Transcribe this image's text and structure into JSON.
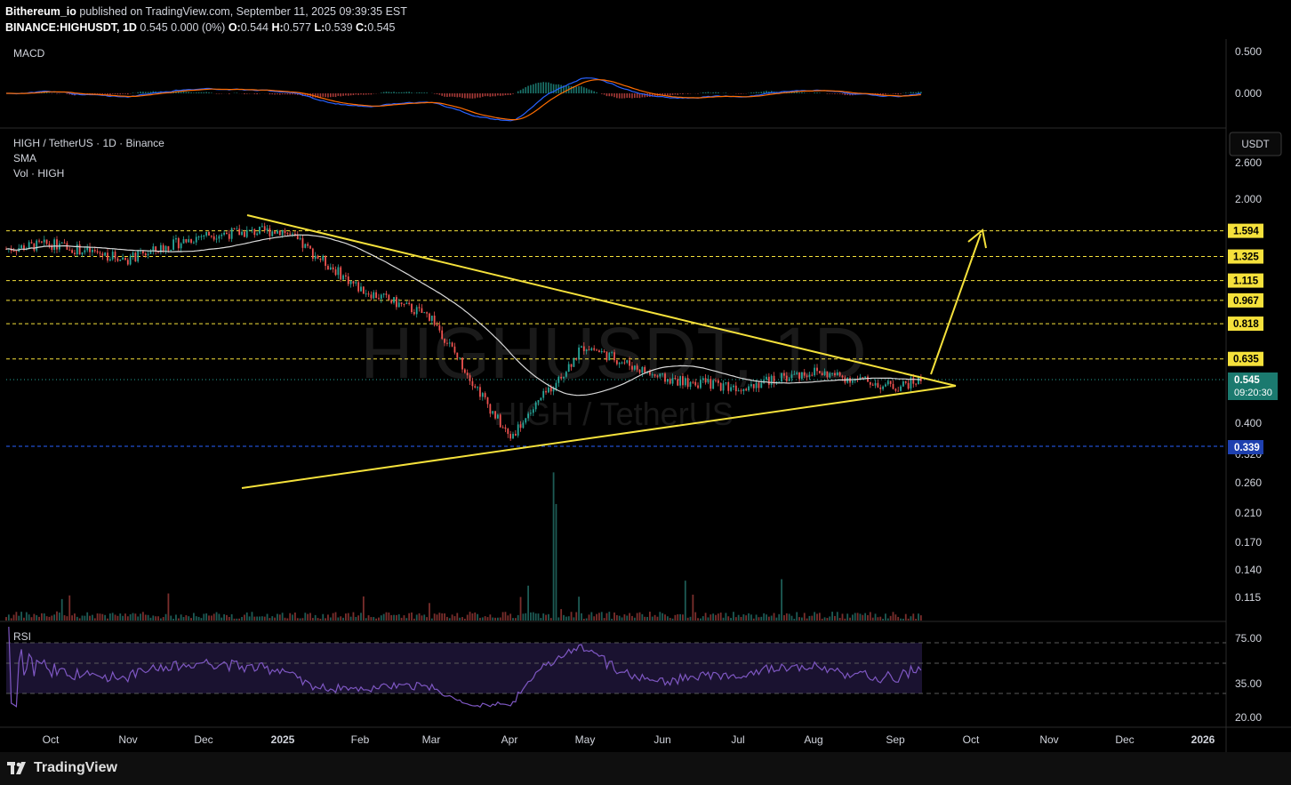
{
  "header": {
    "author": "Bithereum_io",
    "published": "published on TradingView.com, September 11, 2025 09:39:35 EST",
    "symbol": "BINANCE:HIGHUSDT, 1D",
    "change": "0.545 0.000 (0%)",
    "o_label": "O:",
    "o": "0.544",
    "h_label": "H:",
    "h": "0.577",
    "l_label": "L:",
    "l": "0.539",
    "c_label": "C:",
    "c": "0.545"
  },
  "macd": {
    "label": "MACD",
    "ticks": [
      "0.500",
      "0.000"
    ]
  },
  "main": {
    "title": "HIGH / TetherUS · 1D · Binance",
    "sma_label": "SMA",
    "vol_label": "Vol · HIGH",
    "currency": "USDT",
    "watermark_symbol": "HIGHUSDT, 1D",
    "watermark_name": "HIGH / TetherUS",
    "price_ticks": [
      "2.600",
      "2.000",
      "0.400",
      "0.320",
      "0.260",
      "0.210",
      "0.170",
      "0.140",
      "0.115"
    ],
    "current_price": "0.545",
    "countdown": "09:20:30",
    "support": "0.339"
  },
  "rsi": {
    "label": "RSI",
    "ticks": [
      "75.00",
      "35.00",
      "20.00"
    ]
  },
  "time_axis": [
    "Oct",
    "Nov",
    "Dec",
    "2025",
    "Feb",
    "Mar",
    "Apr",
    "May",
    "Jun",
    "Jul",
    "Aug",
    "Sep",
    "Oct",
    "Nov",
    "Dec",
    "2026"
  ],
  "footer": {
    "brand": "TradingView"
  },
  "colors": {
    "level_line": "#f5e13b",
    "trend_line": "#f5e13b",
    "support_line": "#2962ff",
    "candle_up": "#26a69a",
    "candle_down": "#ef5350",
    "sma": "#cfcfcf",
    "rsi": "#7e57c2",
    "macd": "#2962ff",
    "signal": "#ff6d00"
  },
  "chart_data": {
    "type": "candlestick",
    "symbol": "HIGH / TetherUS",
    "interval": "1D",
    "exchange": "Binance",
    "y_scale": "log",
    "ylim": [
      0.115,
      2.6
    ],
    "resistance_levels": [
      1.594,
      1.325,
      1.115,
      0.967,
      0.818,
      0.635
    ],
    "support_level": 0.339,
    "last_price": 0.545,
    "monthly_close_approx": {
      "x": [
        "Oct",
        "Nov",
        "Dec",
        "2025",
        "Feb",
        "Mar",
        "Apr",
        "May",
        "Jun",
        "Jul",
        "Aug",
        "Sep"
      ],
      "values": [
        1.45,
        1.3,
        1.55,
        1.6,
        1.05,
        0.86,
        0.36,
        0.7,
        0.55,
        0.52,
        0.58,
        0.545
      ]
    },
    "pattern": "symmetrical triangle",
    "rsi_levels": [
      70,
      50,
      30
    ]
  }
}
